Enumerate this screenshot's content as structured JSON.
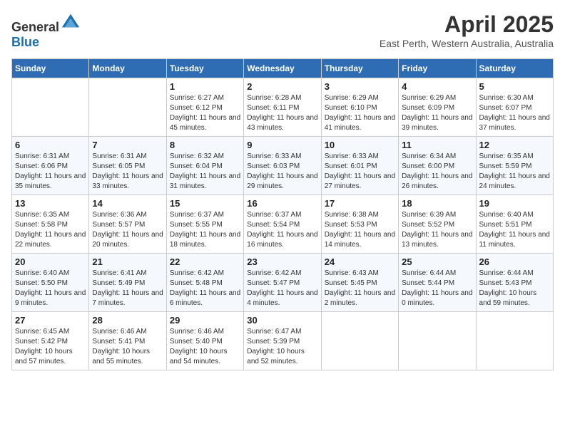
{
  "header": {
    "logo_general": "General",
    "logo_blue": "Blue",
    "month_title": "April 2025",
    "subtitle": "East Perth, Western Australia, Australia"
  },
  "days_of_week": [
    "Sunday",
    "Monday",
    "Tuesday",
    "Wednesday",
    "Thursday",
    "Friday",
    "Saturday"
  ],
  "weeks": [
    [
      null,
      null,
      {
        "day": 1,
        "sunrise": "6:27 AM",
        "sunset": "6:12 PM",
        "daylight": "11 hours and 45 minutes."
      },
      {
        "day": 2,
        "sunrise": "6:28 AM",
        "sunset": "6:11 PM",
        "daylight": "11 hours and 43 minutes."
      },
      {
        "day": 3,
        "sunrise": "6:29 AM",
        "sunset": "6:10 PM",
        "daylight": "11 hours and 41 minutes."
      },
      {
        "day": 4,
        "sunrise": "6:29 AM",
        "sunset": "6:09 PM",
        "daylight": "11 hours and 39 minutes."
      },
      {
        "day": 5,
        "sunrise": "6:30 AM",
        "sunset": "6:07 PM",
        "daylight": "11 hours and 37 minutes."
      }
    ],
    [
      {
        "day": 6,
        "sunrise": "6:31 AM",
        "sunset": "6:06 PM",
        "daylight": "11 hours and 35 minutes."
      },
      {
        "day": 7,
        "sunrise": "6:31 AM",
        "sunset": "6:05 PM",
        "daylight": "11 hours and 33 minutes."
      },
      {
        "day": 8,
        "sunrise": "6:32 AM",
        "sunset": "6:04 PM",
        "daylight": "11 hours and 31 minutes."
      },
      {
        "day": 9,
        "sunrise": "6:33 AM",
        "sunset": "6:03 PM",
        "daylight": "11 hours and 29 minutes."
      },
      {
        "day": 10,
        "sunrise": "6:33 AM",
        "sunset": "6:01 PM",
        "daylight": "11 hours and 27 minutes."
      },
      {
        "day": 11,
        "sunrise": "6:34 AM",
        "sunset": "6:00 PM",
        "daylight": "11 hours and 26 minutes."
      },
      {
        "day": 12,
        "sunrise": "6:35 AM",
        "sunset": "5:59 PM",
        "daylight": "11 hours and 24 minutes."
      }
    ],
    [
      {
        "day": 13,
        "sunrise": "6:35 AM",
        "sunset": "5:58 PM",
        "daylight": "11 hours and 22 minutes."
      },
      {
        "day": 14,
        "sunrise": "6:36 AM",
        "sunset": "5:57 PM",
        "daylight": "11 hours and 20 minutes."
      },
      {
        "day": 15,
        "sunrise": "6:37 AM",
        "sunset": "5:55 PM",
        "daylight": "11 hours and 18 minutes."
      },
      {
        "day": 16,
        "sunrise": "6:37 AM",
        "sunset": "5:54 PM",
        "daylight": "11 hours and 16 minutes."
      },
      {
        "day": 17,
        "sunrise": "6:38 AM",
        "sunset": "5:53 PM",
        "daylight": "11 hours and 14 minutes."
      },
      {
        "day": 18,
        "sunrise": "6:39 AM",
        "sunset": "5:52 PM",
        "daylight": "11 hours and 13 minutes."
      },
      {
        "day": 19,
        "sunrise": "6:40 AM",
        "sunset": "5:51 PM",
        "daylight": "11 hours and 11 minutes."
      }
    ],
    [
      {
        "day": 20,
        "sunrise": "6:40 AM",
        "sunset": "5:50 PM",
        "daylight": "11 hours and 9 minutes."
      },
      {
        "day": 21,
        "sunrise": "6:41 AM",
        "sunset": "5:49 PM",
        "daylight": "11 hours and 7 minutes."
      },
      {
        "day": 22,
        "sunrise": "6:42 AM",
        "sunset": "5:48 PM",
        "daylight": "11 hours and 6 minutes."
      },
      {
        "day": 23,
        "sunrise": "6:42 AM",
        "sunset": "5:47 PM",
        "daylight": "11 hours and 4 minutes."
      },
      {
        "day": 24,
        "sunrise": "6:43 AM",
        "sunset": "5:45 PM",
        "daylight": "11 hours and 2 minutes."
      },
      {
        "day": 25,
        "sunrise": "6:44 AM",
        "sunset": "5:44 PM",
        "daylight": "11 hours and 0 minutes."
      },
      {
        "day": 26,
        "sunrise": "6:44 AM",
        "sunset": "5:43 PM",
        "daylight": "10 hours and 59 minutes."
      }
    ],
    [
      {
        "day": 27,
        "sunrise": "6:45 AM",
        "sunset": "5:42 PM",
        "daylight": "10 hours and 57 minutes."
      },
      {
        "day": 28,
        "sunrise": "6:46 AM",
        "sunset": "5:41 PM",
        "daylight": "10 hours and 55 minutes."
      },
      {
        "day": 29,
        "sunrise": "6:46 AM",
        "sunset": "5:40 PM",
        "daylight": "10 hours and 54 minutes."
      },
      {
        "day": 30,
        "sunrise": "6:47 AM",
        "sunset": "5:39 PM",
        "daylight": "10 hours and 52 minutes."
      },
      null,
      null,
      null
    ]
  ],
  "labels": {
    "sunrise": "Sunrise:",
    "sunset": "Sunset:",
    "daylight": "Daylight:"
  }
}
